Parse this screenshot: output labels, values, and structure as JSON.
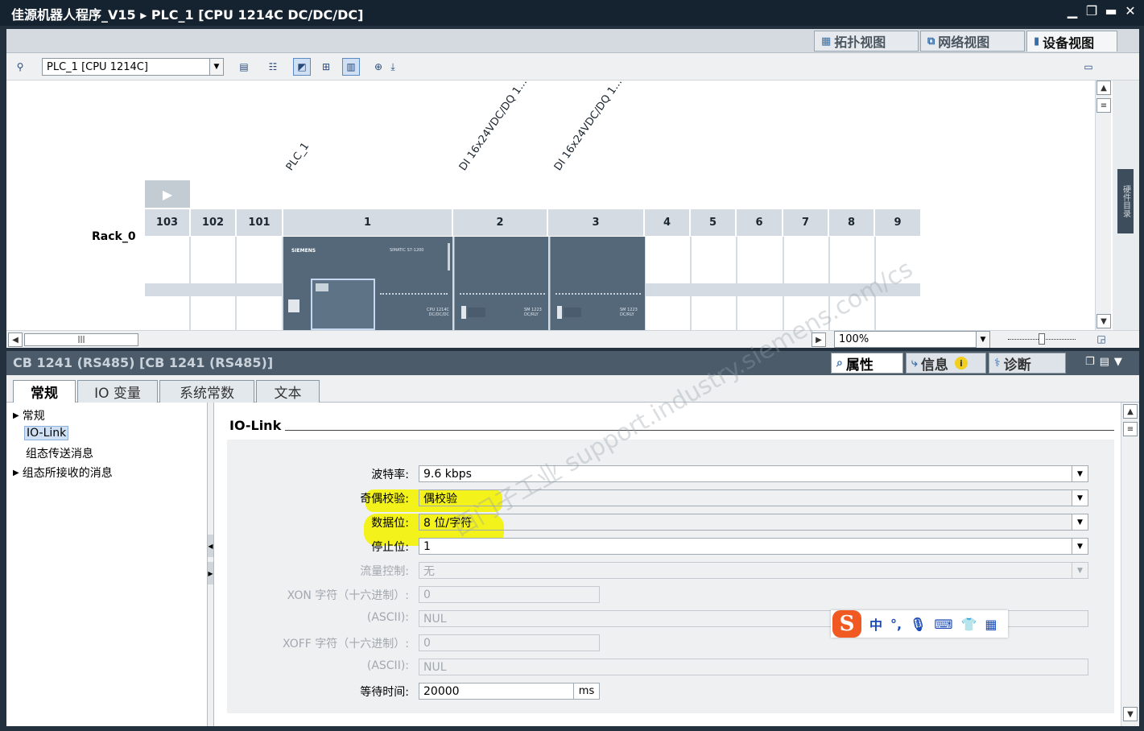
{
  "window": {
    "title": "佳源机器人程序_V15 ▸ PLC_1 [CPU 1214C DC/DC/DC]",
    "controls": [
      "▁",
      "❐",
      "▬",
      "✕"
    ]
  },
  "view_tabs": {
    "topology": "拓扑视图",
    "network": "网络视图",
    "device": "设备视图"
  },
  "toolbar": {
    "device_select": "PLC_1 [CPU 1214C]"
  },
  "rack": {
    "name": "Rack_0",
    "slots": [
      "103",
      "102",
      "101",
      "1",
      "2",
      "3",
      "4",
      "5",
      "6",
      "7",
      "8",
      "9"
    ],
    "module_labels": {
      "plc": "PLC_1",
      "di1": "DI 16x24VDC/DQ 1...",
      "di2": "DI 16x24VDC/DQ 1..."
    },
    "module_text": {
      "brand": "SIEMENS",
      "cpu_line": "SIMATIC S7-1200",
      "cpu_type": "CPU 1214C DC/DC/DC",
      "sm": "SM 1223 DC/RLY"
    }
  },
  "zoom": "100%",
  "inspector": {
    "title": "CB 1241 (RS485) [CB 1241 (RS485)]",
    "tabs": {
      "properties": "属性",
      "info": "信息",
      "diagnostics": "诊断"
    },
    "subtabs": [
      "常规",
      "IO 变量",
      "系统常数",
      "文本"
    ],
    "nav": {
      "general": "常规",
      "iolink": "IO-Link",
      "send": "组态传送消息",
      "recv": "组态所接收的消息"
    },
    "section_title": "IO-Link",
    "fields": {
      "baud_label": "波特率:",
      "baud_value": "9.6 kbps",
      "parity_label": "奇偶校验:",
      "parity_value": "偶校验",
      "databits_label": "数据位:",
      "databits_value": "8 位/字符",
      "stopbits_label": "停止位:",
      "stopbits_value": "1",
      "flow_label": "流量控制:",
      "flow_value": "无",
      "xon_label": "XON 字符（十六进制）:",
      "xon_value": "0",
      "xon_ascii_label": "(ASCII):",
      "xon_ascii_value": "NUL",
      "xoff_label": "XOFF 字符（十六进制）:",
      "xoff_value": "0",
      "xoff_ascii_label": "(ASCII):",
      "xoff_ascii_value": "NUL",
      "wait_label": "等待时间:",
      "wait_value": "20000",
      "wait_unit": "ms"
    }
  },
  "ime": {
    "mode": "中"
  },
  "watermark": "西门子工业 support.industry.siemens.com/cs",
  "side_tab": "硬件目录",
  "colors": {
    "highlight": "#f3f21a",
    "titlebar": "#15222f",
    "module": "#55687a"
  }
}
